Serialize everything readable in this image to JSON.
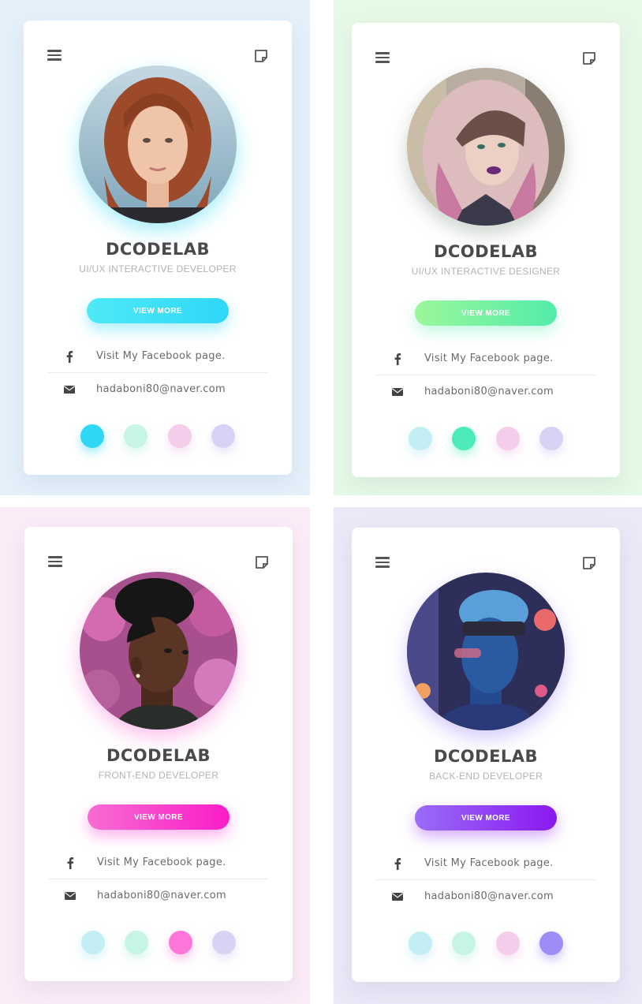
{
  "cards": [
    {
      "name": "DCODELAB",
      "role": "UI/UX INTERACTIVE DEVELOPER",
      "button_label": "VIEW MORE",
      "facebook_text": "Visit My Facebook page.",
      "email_text": "hadaboni80@naver.com",
      "panel_color": "#e4f1fb",
      "button_gradient": [
        "#4fe9f7",
        "#2fd7f7"
      ],
      "selected_dot": 0,
      "avatar_palette": {
        "bg": "#9ab8c8",
        "hair": "#9c4a2a",
        "skin": "#f0c4a8"
      },
      "accent": "#3fd9f6"
    },
    {
      "name": "DCODELAB",
      "role": "UI/UX INTERACTIVE DESIGNER",
      "button_label": "VIEW MORE",
      "facebook_text": "Visit My Facebook page.",
      "email_text": "hadaboni80@naver.com",
      "panel_color": "#e6f9e6",
      "button_gradient": [
        "#9bf79a",
        "#52ecab"
      ],
      "selected_dot": 1,
      "avatar_palette": {
        "bg": "#b0a89c",
        "hair": "#d8b8b8",
        "skin": "#e8c8b8"
      },
      "accent": "#4cebb9"
    },
    {
      "name": "DCODELAB",
      "role": "FRONT-END DEVELOPER",
      "button_label": "VIEW MORE",
      "facebook_text": "Visit My Facebook page.",
      "email_text": "hadaboni80@naver.com",
      "panel_color": "#fcecf8",
      "button_gradient": [
        "#f76cd2",
        "#fa1cc8"
      ],
      "selected_dot": 2,
      "avatar_palette": {
        "bg": "#b44a94",
        "hair": "#1a1a1a",
        "skin": "#5a3424"
      },
      "accent": "#fb76d8"
    },
    {
      "name": "DCODELAB",
      "role": "BACK-END DEVELOPER",
      "button_label": "VIEW MORE",
      "facebook_text": "Visit My Facebook page.",
      "email_text": "hadaboni80@naver.com",
      "panel_color": "#ece8f8",
      "button_gradient": [
        "#9a6cf8",
        "#8a18f0"
      ],
      "selected_dot": 3,
      "avatar_palette": {
        "bg": "#3a3a6a",
        "hair": "#4a8ad0",
        "skin": "#2a5aa0"
      },
      "accent": "#a08cf7"
    }
  ],
  "dot_colors": {
    "inactive": [
      "#c2eef4",
      "#c6f4e6",
      "#f4cdea",
      "#dad2f4"
    ],
    "active": [
      "#2ed8f4",
      "#4cebb9",
      "#fb76d8",
      "#a08cf7"
    ]
  },
  "icons": {
    "menu": "hamburger-menu-icon",
    "note": "note-icon",
    "facebook": "facebook-icon",
    "email": "envelope-icon"
  }
}
